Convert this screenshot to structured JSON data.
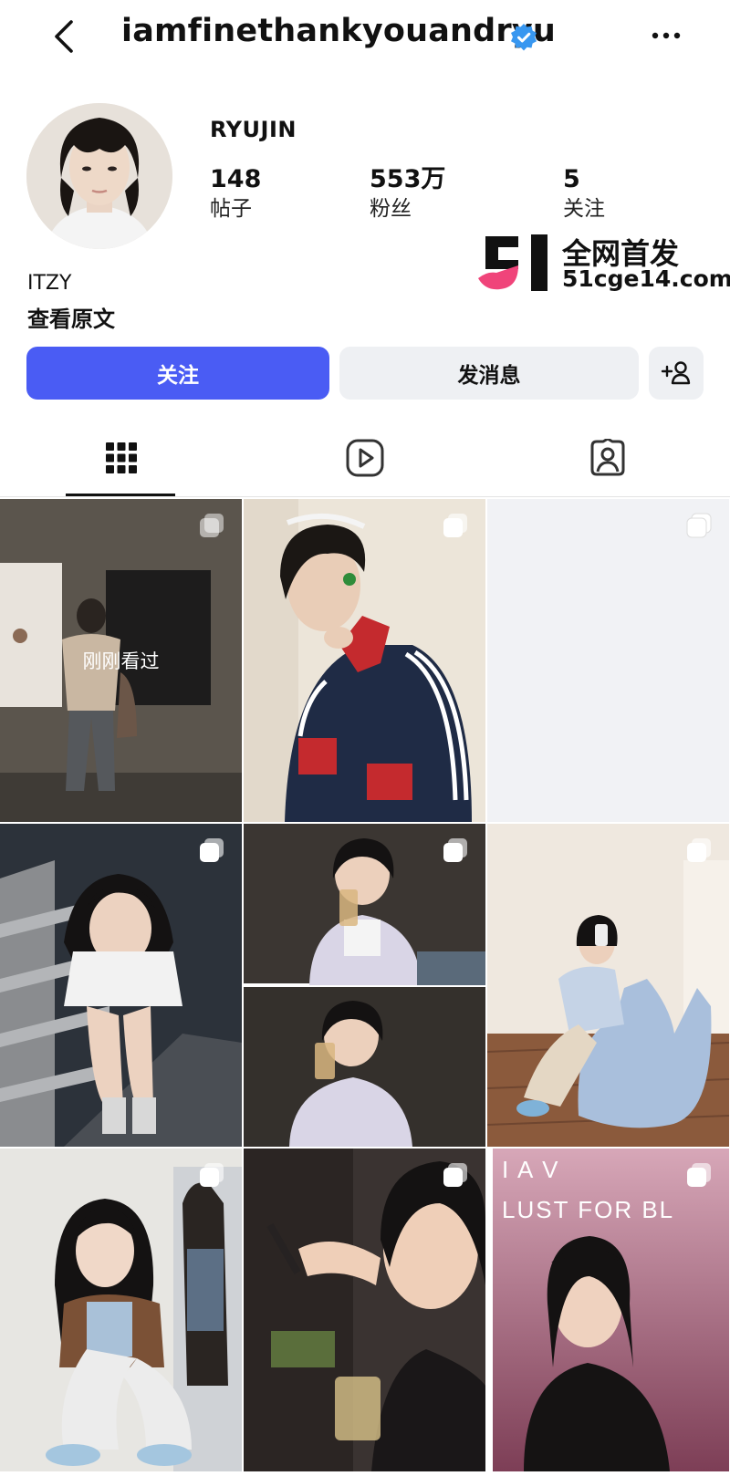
{
  "header": {
    "username": "iamfinethankyouandryu",
    "back_icon": "chevron-left-icon",
    "verified_icon": "verified-badge-icon",
    "more_icon": "more-horizontal-icon"
  },
  "profile": {
    "display_name": "RYUJIN",
    "stats": [
      {
        "value": "148",
        "label": "帖子"
      },
      {
        "value": "553万",
        "label": "粉丝"
      },
      {
        "value": "5",
        "label": "关注"
      }
    ],
    "bio": "ITZY",
    "see_original": "查看原文"
  },
  "watermark": {
    "title": "全网首发",
    "site": "51cge14.com"
  },
  "actions": {
    "follow": "关注",
    "message": "发消息",
    "add_user_icon": "add-person-icon"
  },
  "tabs": [
    {
      "name": "grid",
      "icon": "grid-icon",
      "active": true
    },
    {
      "name": "reels",
      "icon": "play-icon",
      "active": false
    },
    {
      "name": "tagged",
      "icon": "tagged-person-icon",
      "active": false
    }
  ],
  "posts": {
    "recent_label": "刚刚看过",
    "post8_text": "LUST FOR BL",
    "post8_top_text": "I  A  V"
  },
  "colors": {
    "accent": "#4a5cf4",
    "verified": "#3897f0",
    "secondary_button": "#eef0f3"
  }
}
